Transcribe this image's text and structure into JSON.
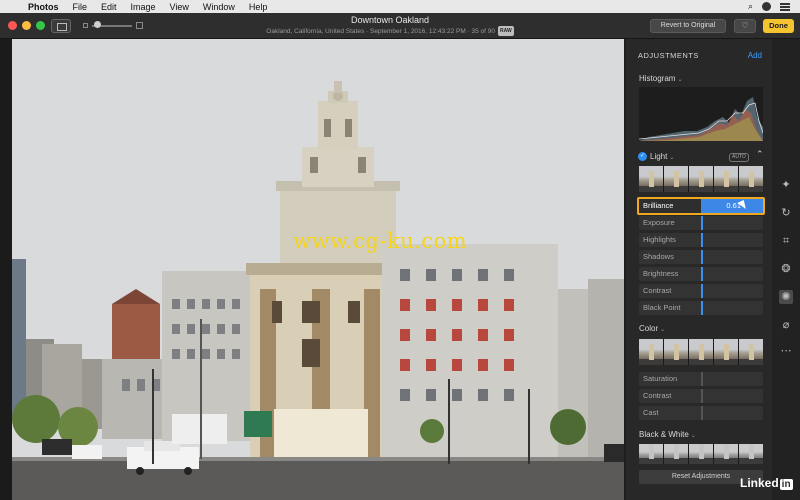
{
  "menubar": {
    "app": "Photos",
    "items": [
      "File",
      "Edit",
      "Image",
      "View",
      "Window",
      "Help"
    ]
  },
  "toolbar": {
    "title": "Downtown Oakland",
    "subtitle": "Oakland, California, United States · September 1, 2016, 12:43:22 PM · 35 of 90",
    "raw_badge": "RAW",
    "revert_label": "Revert to Original",
    "heart_icon": "heart-icon",
    "done_label": "Done"
  },
  "watermark": "www.cg-ku.com",
  "panel": {
    "header": "ADJUSTMENTS",
    "add_label": "Add",
    "histogram_title": "Histogram",
    "light": {
      "title": "Light",
      "auto_label": "AUTO",
      "selected": {
        "label": "Brilliance",
        "value": "0.61",
        "level": 0.61
      },
      "sliders": [
        "Exposure",
        "Highlights",
        "Shadows",
        "Brightness",
        "Contrast",
        "Black Point"
      ]
    },
    "color": {
      "title": "Color",
      "sliders": [
        "Saturation",
        "Contrast",
        "Cast"
      ]
    },
    "bw": {
      "title": "Black & White"
    },
    "reset_label": "Reset Adjustments"
  },
  "colors": {
    "accent_blue": "#3d87e6",
    "selection_orange": "#f0a820",
    "done_yellow": "#f4c430",
    "watermark_yellow": "#f5d51a"
  },
  "brand": {
    "text": "Linked",
    "in": "in"
  }
}
